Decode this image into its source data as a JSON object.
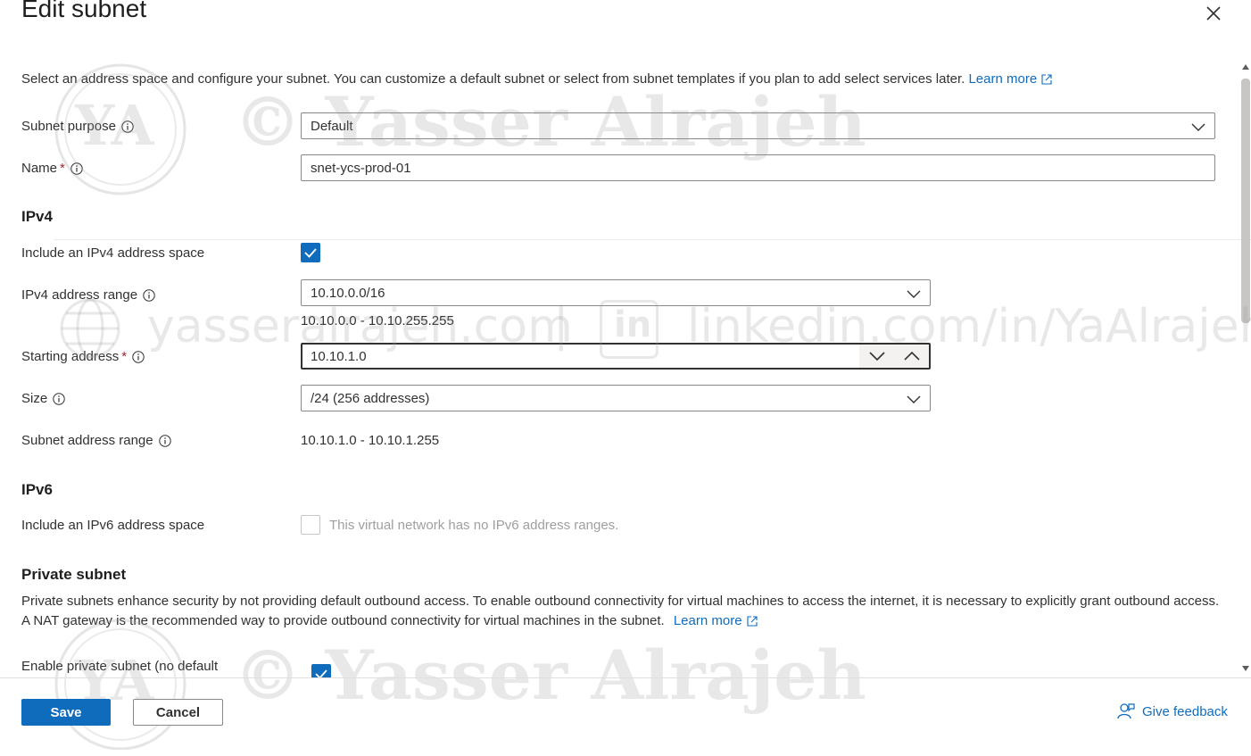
{
  "panel": {
    "title": "Edit subnet",
    "intro_text": "Select an address space and configure your subnet. You can customize a default subnet or select from subnet templates if you plan to add select services later.",
    "learn_more": "Learn more"
  },
  "form": {
    "subnet_purpose": {
      "label": "Subnet purpose",
      "value": "Default"
    },
    "name": {
      "label": "Name",
      "required": "*",
      "value": "snet-ycs-prod-01"
    },
    "ipv4": {
      "heading": "IPv4",
      "include_label": "Include an IPv4 address space",
      "include_checked": true,
      "address_range_label": "IPv4 address range",
      "address_range_value": "10.10.0.0/16",
      "address_range_hint": "10.10.0.0 - 10.10.255.255",
      "starting_label": "Starting address",
      "starting_required": "*",
      "starting_value": "10.10.1.0",
      "size_label": "Size",
      "size_value": "/24 (256 addresses)",
      "subnet_range_label": "Subnet address range",
      "subnet_range_value": "10.10.1.0 - 10.10.1.255"
    },
    "ipv6": {
      "heading": "IPv6",
      "include_label": "Include an IPv6 address space",
      "include_checked": false,
      "disabled_text": "This virtual network has no IPv6 address ranges."
    },
    "private_subnet": {
      "heading": "Private subnet",
      "description": "Private subnets enhance security by not providing default outbound access. To enable outbound connectivity for virtual machines to access the internet, it is necessary to explicitly grant outbound access. A NAT gateway is the recommended way to provide outbound connectivity for virtual machines in the subnet.",
      "learn_more": "Learn more",
      "enable_label": "Enable private subnet (no default",
      "enable_checked": true
    }
  },
  "footer": {
    "save": "Save",
    "cancel": "Cancel",
    "feedback": "Give feedback"
  },
  "watermark": {
    "name": "© Yasser Alrajeh",
    "monogram": "YA",
    "website": "yasseralrajeh.com",
    "separator": "|",
    "linkedin_badge": "in",
    "linkedin": "linkedin.com/in/YaAlrajeh"
  },
  "colors": {
    "accent": "#0f6cbd",
    "text": "#323130",
    "required": "#a4262c",
    "border": "#8a8886"
  }
}
